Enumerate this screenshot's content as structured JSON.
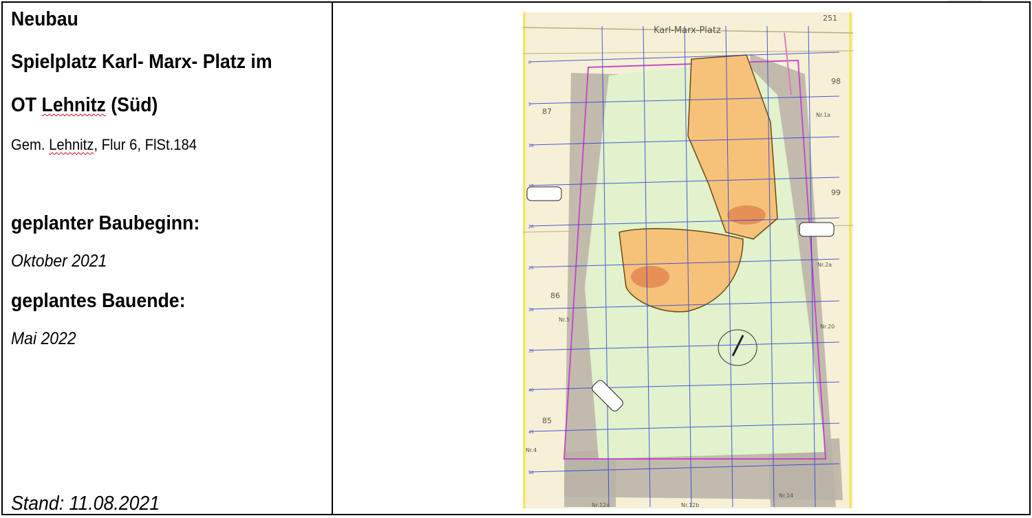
{
  "header": {
    "line1": "Neubau",
    "line2": "Spielplatz Karl- Marx- Platz im",
    "line3_prefix": "OT ",
    "line3_word": "Lehnitz",
    "line3_suffix": " (Süd)",
    "gem_prefix": "Gem. ",
    "gem_word": "Lehnitz",
    "gem_suffix": ", Flur 6, FlSt.184"
  },
  "schedule": {
    "start_label": "geplanter Baubeginn:",
    "start_value": "Oktober 2021",
    "end_label": "geplantes Bauende:",
    "end_value": "Mai 2022"
  },
  "footer": {
    "status": "Stand: 11.08.2021"
  },
  "map": {
    "street": "Karl-Marx-Platz",
    "parcels": [
      "251",
      "98",
      "87",
      "99",
      "86",
      "85"
    ],
    "house_numbers": [
      "Nr.1a",
      "Nr.2a",
      "Nr.5",
      "Nr.20",
      "Nr.4",
      "Nr.12a",
      "Nr.12b",
      "Nr.14"
    ],
    "grid_labels": [
      "0",
      "5",
      "10",
      "15",
      "20",
      "25",
      "30",
      "35",
      "40",
      "45",
      "50"
    ],
    "colors": {
      "background": "#f6f0d6",
      "green_area": "#e1f2cc",
      "play_area": "#f6c27a",
      "gray_road": "#b9b2a6",
      "grid": "#2a3fd6",
      "boundary": "#c44bc4"
    }
  }
}
